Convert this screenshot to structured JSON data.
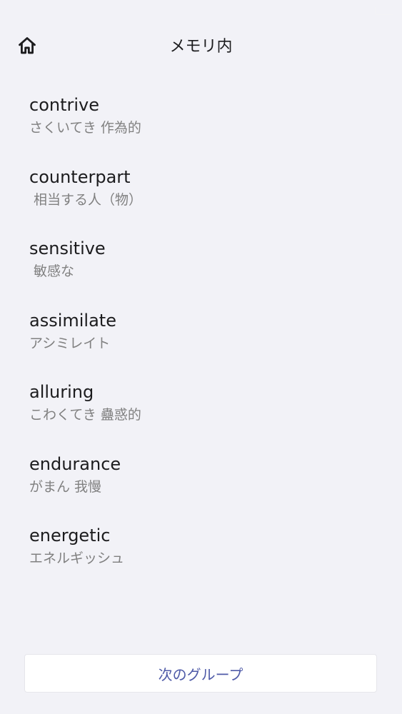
{
  "nav": {
    "title": "メモリ内"
  },
  "words": [
    {
      "word": "contrive",
      "reading": "さくいてき 作為的"
    },
    {
      "word": "counterpart",
      "reading": " 相当する人（物）"
    },
    {
      "word": "sensitive",
      "reading": " 敏感な"
    },
    {
      "word": "assimilate",
      "reading": "アシミレイト"
    },
    {
      "word": "alluring",
      "reading": "こわくてき 蠱惑的"
    },
    {
      "word": "endurance",
      "reading": "がまん 我慢"
    },
    {
      "word": "energetic",
      "reading": "エネルギッシュ"
    }
  ],
  "footer": {
    "next_group_label": "次のグループ"
  },
  "icons": {
    "home": "home-icon"
  },
  "colors": {
    "background": "#f2f2f7",
    "accent": "#4f5ba8",
    "secondary_text": "#808080"
  }
}
